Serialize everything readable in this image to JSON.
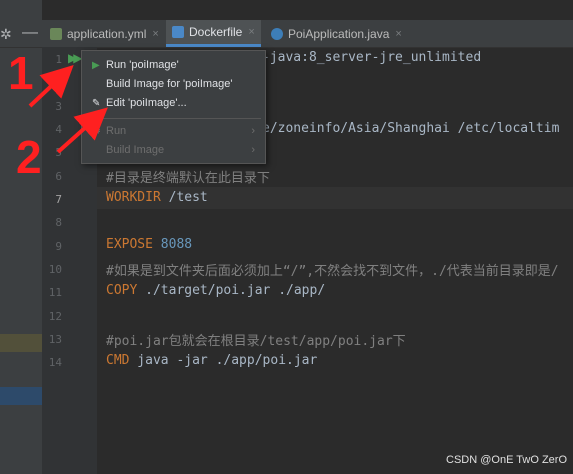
{
  "tabs": [
    {
      "label": "application.yml",
      "icon": "yaml-icon",
      "color": "#6a8759"
    },
    {
      "label": "Dockerfile",
      "icon": "docker-icon",
      "color": "#4a88c7",
      "active": true
    },
    {
      "label": "PoiApplication.java",
      "icon": "java-class-icon",
      "color": "#4a88c7"
    }
  ],
  "close_glyph": "×",
  "line_numbers": [
    "1",
    "2",
    "3",
    "4",
    "5",
    "6",
    "7",
    "8",
    "9",
    "10",
    "11",
    "12",
    "13",
    "14"
  ],
  "code": {
    "line1_rest": "-java:8_server-jre_unlimited",
    "line4_rest": "e/zoneinfo/Asia/Shanghai /etc/localtim",
    "line6": "#目录是终端默认在此目录下",
    "line7_kw": "WORKDIR",
    "line7_val": " /test",
    "line9_kw": "EXPOSE",
    "line9_val": "8088",
    "line10": "#如果是到文件夹后面必须加上“/”,不然会找不到文件，./代表当前目录即是/",
    "line11_kw": "COPY",
    "line11_val": " ./target/poi.jar ./app/",
    "line13": "#poi.jar包就会在根目录/test/app/poi.jar下",
    "line14_kw": "CMD",
    "line14_val": " java -jar ./app/poi.jar"
  },
  "context_menu": {
    "items": [
      {
        "label": "Run 'poiImage'",
        "icon": "run-icon",
        "enabled": true
      },
      {
        "label": "Build Image for 'poiImage'",
        "icon": "",
        "enabled": true
      },
      {
        "label": "Edit 'poiImage'...",
        "icon": "edit-icon",
        "enabled": true
      },
      {
        "label": "Run",
        "icon": "run-target-icon",
        "enabled": false,
        "submenu": true
      },
      {
        "label": "Build Image",
        "icon": "",
        "enabled": false,
        "submenu": true
      }
    ]
  },
  "annotations": [
    "1",
    "2"
  ],
  "watermark": "CSDN @OnE TwO ZerO"
}
